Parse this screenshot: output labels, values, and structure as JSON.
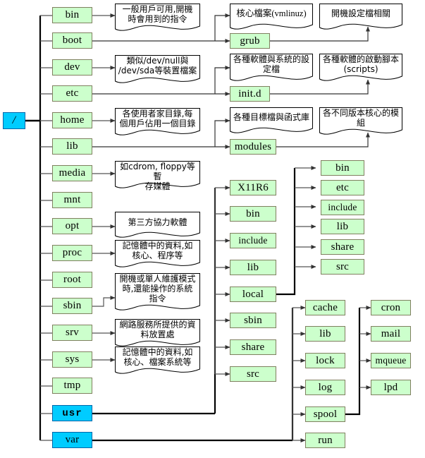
{
  "diagram": {
    "title": "Linux Filesystem Hierarchy (FHS) tree",
    "colors": {
      "node_fill": "#ccffcc",
      "node_border": "#808060",
      "highlight_fill": "#00ccff",
      "highlight_border": "#0066aa",
      "line": "#555555",
      "line_bold": "#000000",
      "doc_border": "#000000",
      "background": "#ffffff"
    },
    "root": {
      "label": "/"
    },
    "top_level": [
      {
        "label": "bin"
      },
      {
        "label": "boot"
      },
      {
        "label": "dev"
      },
      {
        "label": "etc"
      },
      {
        "label": "home"
      },
      {
        "label": "lib"
      },
      {
        "label": "media"
      },
      {
        "label": "mnt"
      },
      {
        "label": "opt"
      },
      {
        "label": "proc"
      },
      {
        "label": "root"
      },
      {
        "label": "sbin"
      },
      {
        "label": "srv"
      },
      {
        "label": "sys"
      },
      {
        "label": "tmp"
      },
      {
        "label": "usr"
      },
      {
        "label": "var"
      }
    ],
    "descriptions": {
      "bin": "一般用戶可用,開機時會用到的指令",
      "dev": "類似/dev/null與 /dev/sda等裝置檔案",
      "home": "各使用者家目錄,每個用戶佔用一個目錄",
      "media": "如cdrom, floppy等暫存媒體",
      "opt": "第三方協力軟體",
      "proc": "記憶體中的資料,如核心、程序等",
      "sbin": "開機或單人維護模式時,還能操作的系統指令",
      "srv": "網路服務所提供的資料放置處",
      "sys": "記憶體中的資料,如核心、檔案系統等",
      "boot_kernel": "核心檔案(vmlinuz)",
      "boot_grub_desc": "開機設定檔相關",
      "etc_conf": "各種軟體與系統的設定檔",
      "etc_initd_desc": "各種軟體的啟動腳本(scripts)",
      "lib_objects": "各種目標檔與函式庫",
      "lib_modules_desc": "各不同版本核心的模組"
    },
    "description_lines": {
      "bin": [
        "一般用戶可用,開機",
        "時會用到的指令"
      ],
      "dev": [
        "類似/dev/null與",
        "/dev/sda等裝置檔案"
      ],
      "home": [
        "各使用者家目錄,每",
        "個用戶佔用一個目錄"
      ],
      "media": [
        "如cdrom, floppy等暫",
        "存媒體"
      ],
      "opt": [
        "第三方協力軟體"
      ],
      "proc": [
        "記憶體中的資料,如",
        "核心、程序等"
      ],
      "sbin": [
        "開機或單人維護模式",
        "時,還能操作的系統",
        "指令"
      ],
      "srv": [
        "網路服務所提供的資",
        "料放置處"
      ],
      "sys": [
        "記憶體中的資料,如",
        "核心、檔案系統等"
      ],
      "boot_kernel": [
        "核心檔案(vmlinuz)"
      ],
      "boot_grub_desc": [
        "開機設定檔相關"
      ],
      "etc_conf": [
        "各種軟體與系統的設",
        "定檔"
      ],
      "etc_initd_desc": [
        "各種軟體的啟動腳本",
        "(scripts)"
      ],
      "lib_objects": [
        "各種目標檔與函式庫"
      ],
      "lib_modules_desc": [
        "各不同版本核心的模",
        "組"
      ]
    },
    "sub_nodes": {
      "boot_grub": "grub",
      "etc_initd": "init.d",
      "lib_modules": "modules"
    },
    "usr_children": [
      {
        "label": "X11R6"
      },
      {
        "label": "bin"
      },
      {
        "label": "include"
      },
      {
        "label": "lib"
      },
      {
        "label": "local"
      },
      {
        "label": "sbin"
      },
      {
        "label": "share"
      },
      {
        "label": "src"
      }
    ],
    "usr_local_children": [
      {
        "label": "bin"
      },
      {
        "label": "etc"
      },
      {
        "label": "include"
      },
      {
        "label": "lib"
      },
      {
        "label": "share"
      },
      {
        "label": "src"
      }
    ],
    "var_children": [
      {
        "label": "cache"
      },
      {
        "label": "lib"
      },
      {
        "label": "lock"
      },
      {
        "label": "log"
      },
      {
        "label": "spool"
      },
      {
        "label": "run"
      }
    ],
    "var_spool_children": [
      {
        "label": "cron"
      },
      {
        "label": "mail"
      },
      {
        "label": "mqueue"
      },
      {
        "label": "lpd"
      }
    ]
  }
}
